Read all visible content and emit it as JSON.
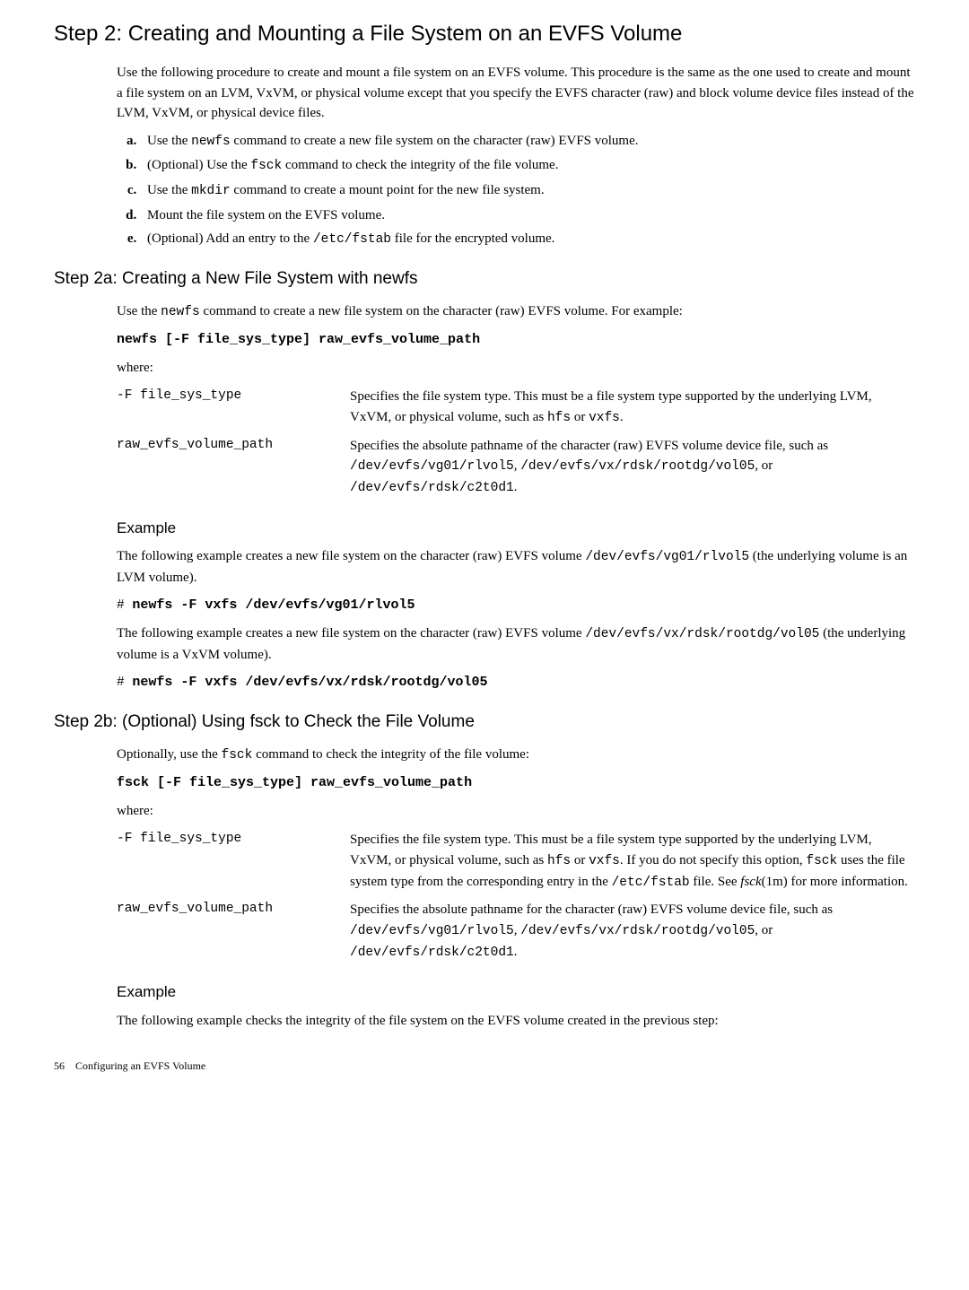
{
  "title": "Step 2: Creating and Mounting a File System on an EVFS Volume",
  "intro": "Use the following procedure to create and mount a file system on an EVFS volume. This procedure is the same as the one used to create and mount a file system on an LVM, VxVM, or physical volume except that you specify the EVFS character (raw) and block volume device files instead of the LVM, VxVM, or physical device files.",
  "steps": {
    "a_pre": "Use the ",
    "a_code": "newfs",
    "a_post": " command to create a new file system on the character (raw) EVFS volume.",
    "b_pre": "(Optional) Use the ",
    "b_code": "fsck",
    "b_post": " command to check the integrity of the file volume.",
    "c_pre": "Use the ",
    "c_code": "mkdir",
    "c_post": " command to create a mount point for the new file system.",
    "d": "Mount the file system on the EVFS volume.",
    "e_pre": "(Optional) Add an entry to the ",
    "e_code": "/etc/fstab",
    "e_post": " file for the encrypted volume."
  },
  "step2a": {
    "title": "Step 2a: Creating a New File System with newfs",
    "intro_pre": "Use the ",
    "intro_code": "newfs",
    "intro_post": " command to create a new file system on the character (raw) EVFS volume. For example:",
    "cmd": "newfs [-F file_sys_type] raw_evfs_volume_path",
    "where": "where:",
    "defs": {
      "term1": "-F file_sys_type",
      "desc1_pre": "Specifies the file system type. This must be a file system type supported by the underlying LVM, VxVM, or physical volume, such as ",
      "desc1_code1": "hfs",
      "desc1_mid": " or ",
      "desc1_code2": "vxfs",
      "desc1_post": ".",
      "term2": "raw_evfs_volume_path",
      "desc2_pre": "Specifies the absolute pathname of the character (raw) EVFS volume device file, such as ",
      "desc2_code1": "/dev/evfs/vg01/rlvol5",
      "desc2_mid1": ", ",
      "desc2_code2": "/dev/evfs/vx/rdsk/rootdg/vol05",
      "desc2_mid2": ", or ",
      "desc2_code3": "/dev/evfs/rdsk/c2t0d1",
      "desc2_post": "."
    },
    "example_title": "Example",
    "ex1_pre": "The following example creates a new file system on the character (raw) EVFS volume ",
    "ex1_code": "/dev/evfs/vg01/rlvol5",
    "ex1_post": " (the underlying volume is an LVM volume).",
    "ex1_cmd_hash": "# ",
    "ex1_cmd": "newfs -F vxfs /dev/evfs/vg01/rlvol5",
    "ex2_pre": "The following example creates a new file system on the character (raw) EVFS volume ",
    "ex2_code": "/dev/evfs/vx/rdsk/rootdg/vol05",
    "ex2_post": " (the underlying volume is a VxVM volume).",
    "ex2_cmd_hash": "# ",
    "ex2_cmd": "newfs -F vxfs /dev/evfs/vx/rdsk/rootdg/vol05"
  },
  "step2b": {
    "title": "Step 2b: (Optional) Using fsck to Check the File Volume",
    "intro_pre": "Optionally, use the ",
    "intro_code": "fsck",
    "intro_post": "  command to check the integrity of the file volume:",
    "cmd": "fsck [-F file_sys_type] raw_evfs_volume_path",
    "where": "where:",
    "defs": {
      "term1": "-F file_sys_type",
      "desc1_pre": "Specifies the file system type. This must be a file system type supported by the underlying LVM, VxVM, or physical volume, such as ",
      "desc1_code1": "hfs",
      "desc1_mid1": " or ",
      "desc1_code2": "vxfs",
      "desc1_mid2": ". If you do not specify this option, ",
      "desc1_code3": "fsck",
      "desc1_mid3": " uses the file system type from the corresponding entry in the ",
      "desc1_code4": "/etc/fstab",
      "desc1_mid4": " file. See ",
      "desc1_em": "fsck",
      "desc1_post": "(1m) for more information.",
      "term2": "raw_evfs_volume_path",
      "desc2_pre": "Specifies the absolute pathname for the character (raw) EVFS volume device file, such as ",
      "desc2_code1": "/dev/evfs/vg01/rlvol5",
      "desc2_mid1": ", ",
      "desc2_code2": "/dev/evfs/vx/rdsk/rootdg/vol05",
      "desc2_mid2": ", or ",
      "desc2_code3": "/dev/evfs/rdsk/c2t0d1",
      "desc2_post": "."
    },
    "example_title": "Example",
    "ex_text": "The following example checks the integrity of the file system on the EVFS volume created in the previous step:"
  },
  "footer": {
    "page": "56",
    "label": "Configuring an EVFS Volume"
  }
}
